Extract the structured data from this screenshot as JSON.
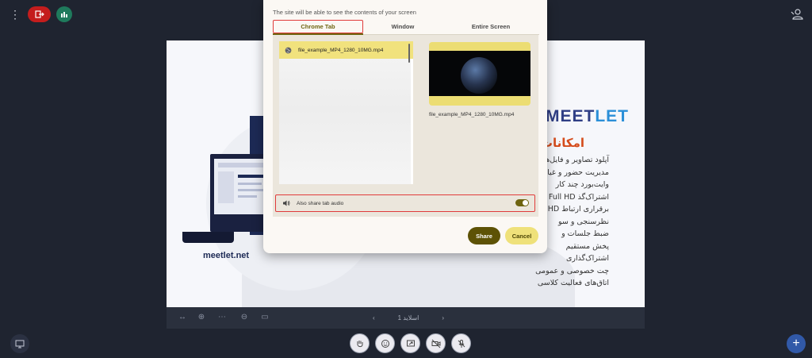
{
  "topbar": {
    "menu_icon": "more-vertical-icon",
    "leave_icon": "leave-icon",
    "stats_icon": "stats-icon",
    "user_icon": "user-icon",
    "leave_color": "#c41d1d",
    "stats_color": "#1f7a5c"
  },
  "slide": {
    "brand": "meetlet.net",
    "logo_dark": "MEET",
    "logo_light": "LET",
    "heading": "امکانات ب",
    "features": [
      "آپلود تصاویر و فایل‌ها",
      "مدیریت حضور و غیا",
      "وایت‌بورد چند کار",
      "اشتراک‌گذ Full HD",
      "برقراری ارتباط HD",
      "نظرسنجی و سو",
      "ضبط جلسات و",
      "پخش مستقیم",
      "اشتراک‌گذاری",
      "چت خصوصی و عمومی",
      "اتاق‌های فعالیت کلاسی"
    ]
  },
  "slide_toolbar": {
    "slide_label": "اسلاید 1",
    "prev_icon": "chevron-left-icon",
    "next_icon": "chevron-right-icon"
  },
  "dialog": {
    "subtitle": "The site will be able to see the contents of your screen",
    "tabs": [
      "Chrome Tab",
      "Window",
      "Entire Screen"
    ],
    "active_tab": "Chrome Tab",
    "tab_item": "file_example_MP4_1280_10MG.mp4",
    "preview_label": "file_example_MP4_1280_10MG.mp4",
    "audio_label": "Also share tab audio",
    "audio_enabled": true,
    "share": "Share",
    "cancel": "Cancel",
    "accent": "#6e6410",
    "highlight": "#f1e27d"
  },
  "bottom": {
    "buttons": [
      "hand-icon",
      "emoji-icon",
      "share-screen-icon",
      "camera-icon",
      "mic-icon"
    ],
    "present_icon": "presentation-icon",
    "plus_icon": "plus-icon"
  }
}
